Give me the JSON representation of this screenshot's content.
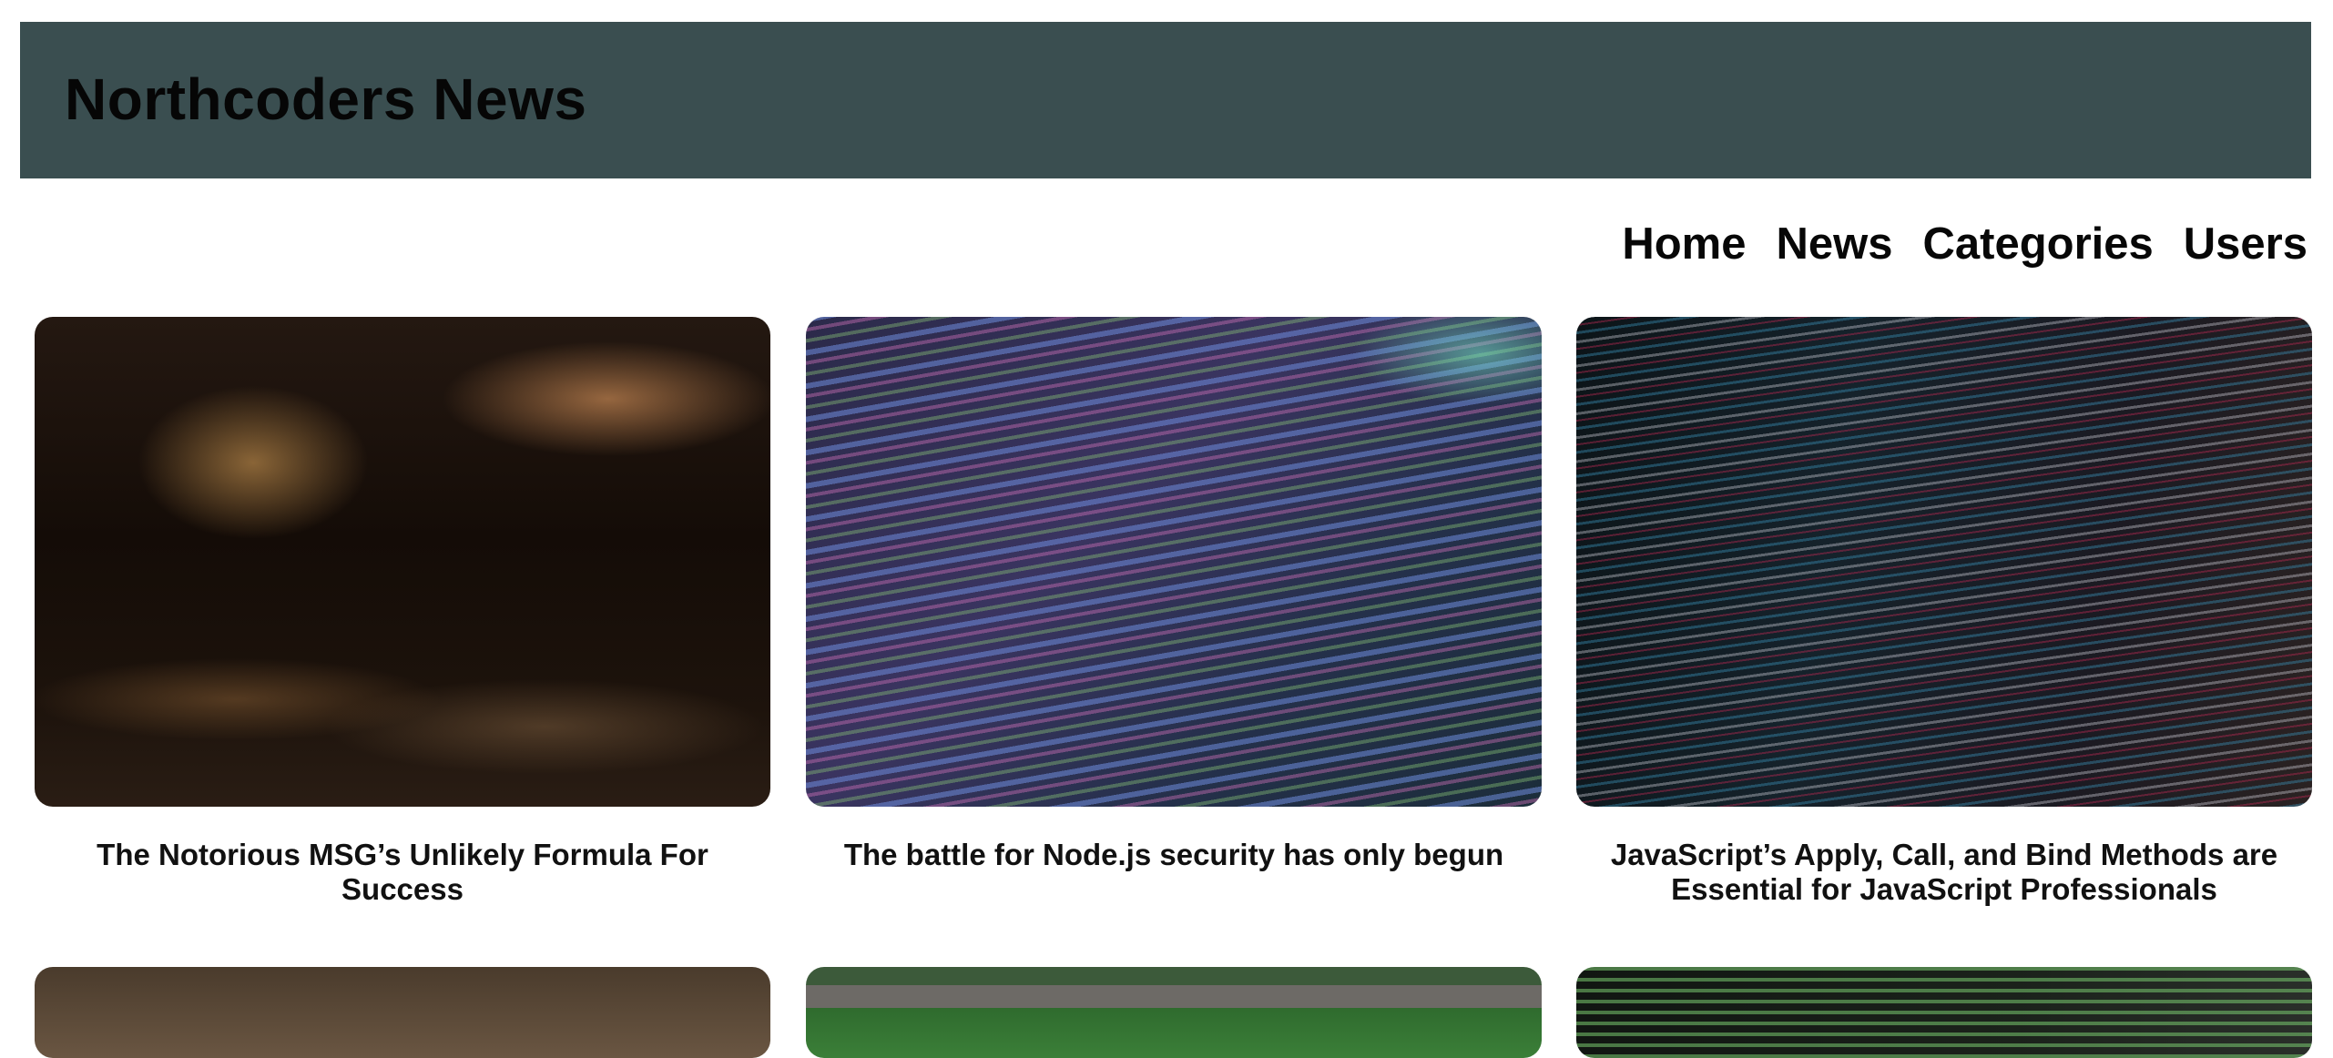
{
  "header": {
    "title": "Northcoders News",
    "background_color": "#3a4e50"
  },
  "nav": {
    "items": [
      {
        "label": "Home"
      },
      {
        "label": "News"
      },
      {
        "label": "Categories"
      },
      {
        "label": "Users"
      }
    ]
  },
  "articles": [
    {
      "title": "The Notorious MSG’s Unlikely Formula For Success",
      "image": "food-kitchen-photo"
    },
    {
      "title": "The battle for Node.js security has only begun",
      "image": "colorful-code-photo"
    },
    {
      "title": "JavaScript’s Apply, Call, and Bind Methods are Essential for JavaScript Professionals",
      "image": "dark-code-photo"
    },
    {
      "title": "",
      "image": "blurred-brown-photo"
    },
    {
      "title": "",
      "image": "aerial-field-photo"
    },
    {
      "title": "",
      "image": "terminal-code-photo"
    }
  ]
}
